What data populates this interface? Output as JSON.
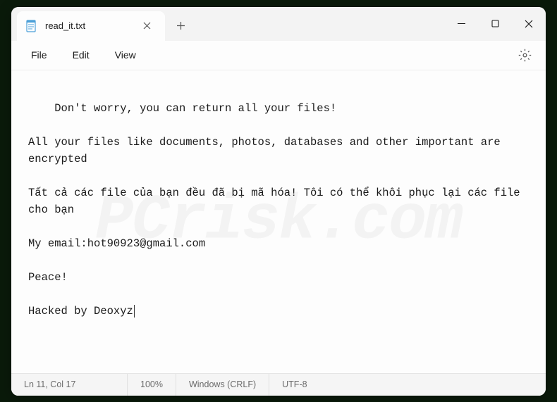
{
  "tab": {
    "title": "read_it.txt"
  },
  "menu": {
    "file": "File",
    "edit": "Edit",
    "view": "View"
  },
  "content": {
    "line1": "Don't worry, you can return all your files!",
    "line2": "All your files like documents, photos, databases and other important are encrypted",
    "line3": "Tất cả các file của bạn đều đã bị mã hóa! Tôi có thể khôi phục lại các file cho bạn",
    "line4": "My email:hot90923@gmail.com",
    "line5": "Peace!",
    "line6": "Hacked by Deoxyz"
  },
  "status": {
    "position": "Ln 11, Col 17",
    "zoom": "100%",
    "lineending": "Windows (CRLF)",
    "encoding": "UTF-8"
  },
  "watermark": "PCrisk.com"
}
